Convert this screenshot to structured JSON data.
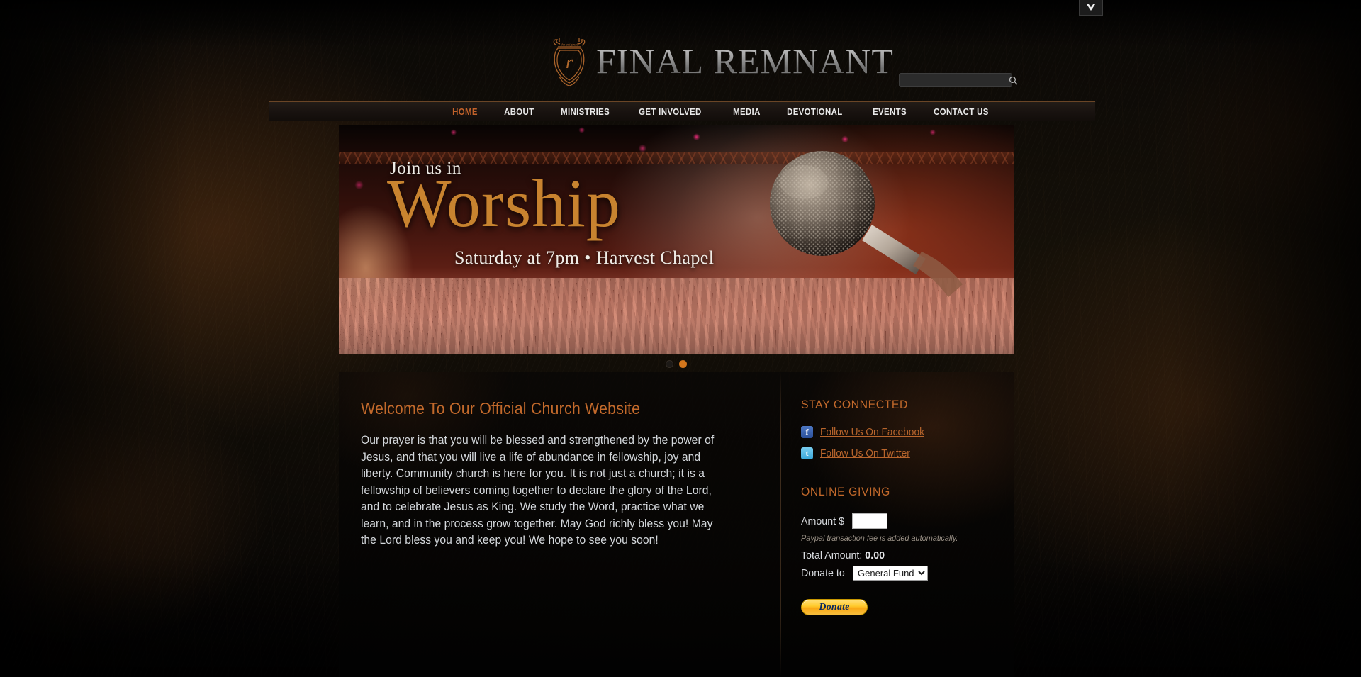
{
  "browser": {
    "chevron_icon": "chevron-down-icon"
  },
  "header": {
    "brand_word_1": "Final",
    "brand_word_2": "Remnant",
    "crest_motto": "the original",
    "crest_letter": "r",
    "search": {
      "value": "",
      "placeholder": "",
      "icon": "search-icon"
    }
  },
  "nav": {
    "items": [
      {
        "label": "HOME",
        "active": true
      },
      {
        "label": "ABOUT",
        "active": false
      },
      {
        "label": "MINISTRIES",
        "active": false
      },
      {
        "label": "GET INVOLVED",
        "active": false
      },
      {
        "label": "MEDIA",
        "active": false
      },
      {
        "label": "DEVOTIONAL",
        "active": false
      },
      {
        "label": "EVENTS",
        "active": false
      },
      {
        "label": "CONTACT US",
        "active": false
      }
    ]
  },
  "hero": {
    "line1": "Join us in",
    "line2": "Worship",
    "line3": "Saturday at 7pm • Harvest Chapel",
    "image_alt": "microphone-over-crowd",
    "dots": [
      {
        "active": false
      },
      {
        "active": true
      }
    ]
  },
  "main": {
    "welcome_title": "Welcome To Our Official Church Website",
    "welcome_body": "Our prayer is that you will be blessed and strengthened by the power of Jesus, and that you will live a life of abundance in fellowship, joy and liberty. Community church is here for you. It is not just a church; it is a fellowship of believers coming together to declare the glory of the Lord, and to celebrate Jesus as King. We study the Word, practice what we learn, and in the process grow together. May God richly bless you! May the Lord bless you and keep you! We hope to see you soon!"
  },
  "sidebar": {
    "stay_connected_title": "STAY CONNECTED",
    "social": [
      {
        "icon": "facebook-icon",
        "glyph": "f",
        "label": "Follow Us On Facebook"
      },
      {
        "icon": "twitter-icon",
        "glyph": "t",
        "label": "Follow Us On Twitter"
      }
    ],
    "giving_title": "ONLINE GIVING",
    "amount_label": "Amount $",
    "amount_value": "",
    "fee_note": "Paypal transaction fee is added automatically.",
    "total_label": "Total Amount:",
    "total_value": "0.00",
    "donate_to_label": "Donate to",
    "fund_selected": "General Fund",
    "fund_options": [
      "General Fund"
    ],
    "donate_button": "Donate"
  },
  "colors": {
    "accent_orange": "#c2692b",
    "hero_gold": "#c8832f",
    "link_orange": "#b8652c",
    "nav_rule": "#6a4526",
    "body_text": "#d4d8dc",
    "dot_active": "#d3761c"
  }
}
